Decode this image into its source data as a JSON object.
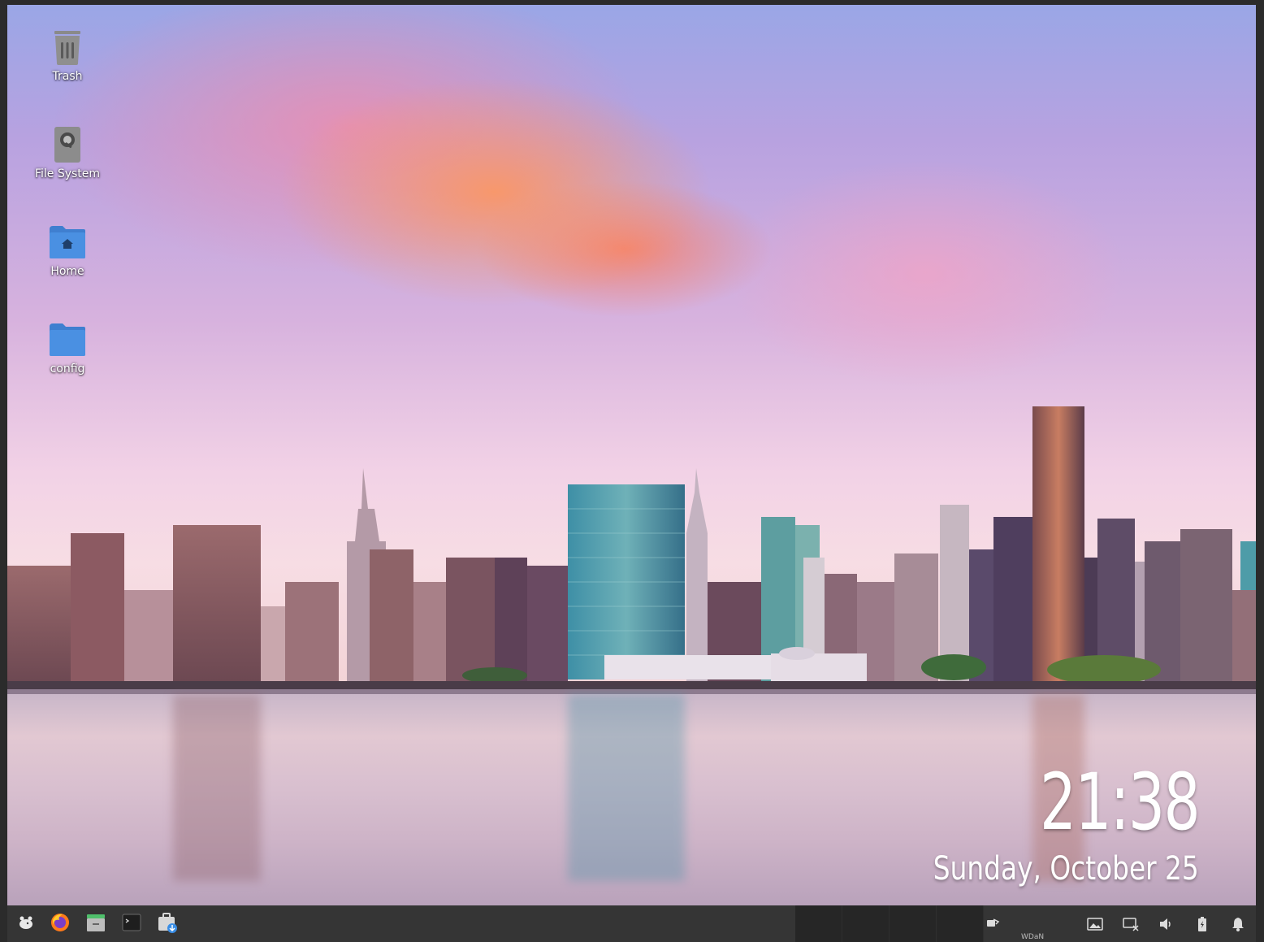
{
  "desktop": {
    "icons": [
      {
        "label": "Trash"
      },
      {
        "label": "File System"
      },
      {
        "label": "Home"
      },
      {
        "label": "config"
      }
    ]
  },
  "clock": {
    "time": "21:38",
    "date": "Sunday, October 25"
  },
  "taskbar": {
    "launchers": [
      "whisker-menu-icon",
      "firefox-icon",
      "file-manager-icon",
      "terminal-icon",
      "software-installer-icon"
    ],
    "workspaces": 4,
    "tray_partial_text": "WDaN",
    "tray": [
      "network-icon",
      "image-viewer-icon",
      "display-icon",
      "volume-icon",
      "battery-icon",
      "notification-bell-icon"
    ]
  },
  "colors": {
    "taskbar": "#353535",
    "workspace": "#262626",
    "folder": "#4a90e2"
  }
}
